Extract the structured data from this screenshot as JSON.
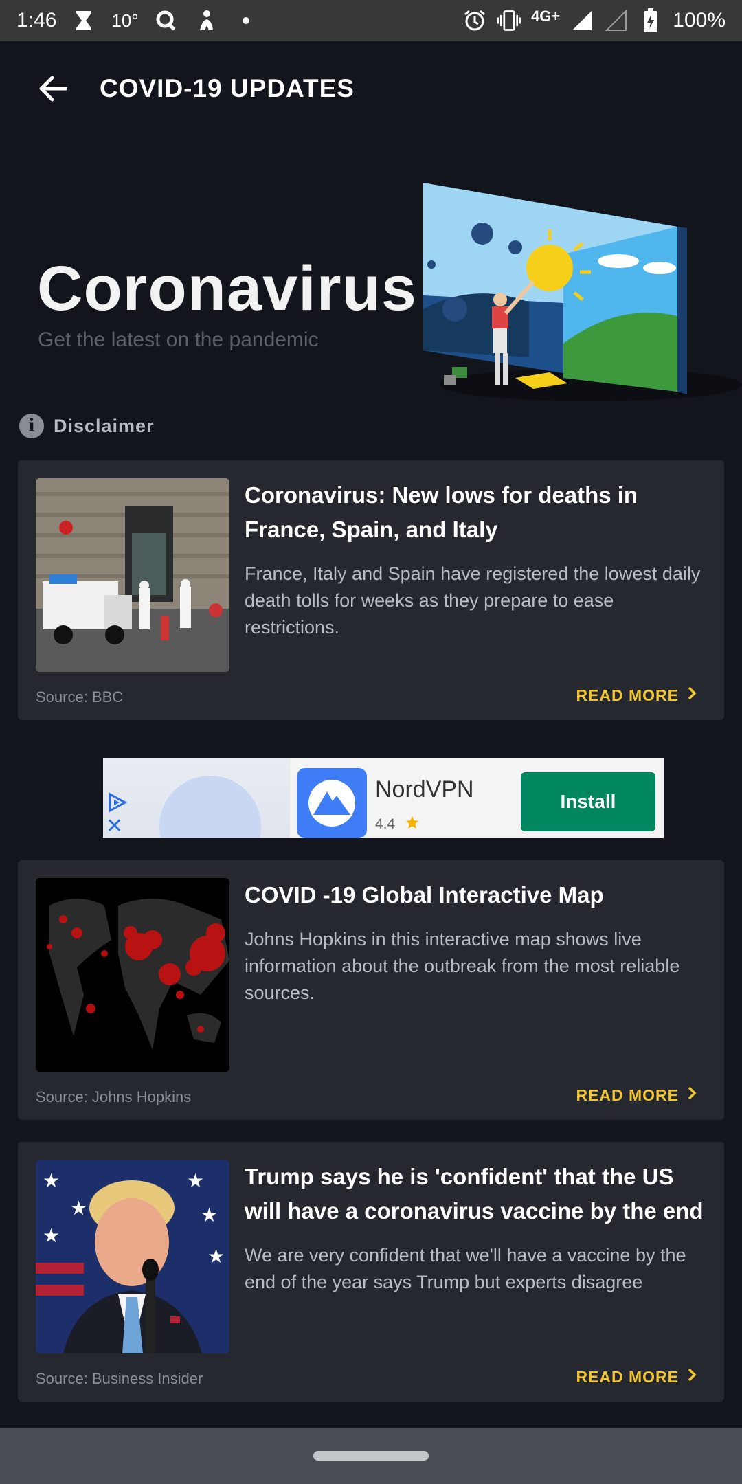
{
  "status_bar": {
    "time": "1:46",
    "temperature": "10°",
    "network": "4G+",
    "battery": "100%",
    "icons": [
      "hourglass-icon",
      "search-icon",
      "figure-icon",
      "dot-icon",
      "alarm-icon",
      "vibrate-icon",
      "signal-icon",
      "signal-empty-icon",
      "battery-charging-icon"
    ]
  },
  "app_bar": {
    "title": "COVID-19 UPDATES",
    "back_icon": "arrow-left-icon"
  },
  "hero": {
    "title": "Coronavirus",
    "subtitle": "Get the latest on the pandemic",
    "illustration": "person-painting-wall-illustration"
  },
  "disclaimer": {
    "label": "Disclaimer",
    "icon": "info-icon"
  },
  "articles": [
    {
      "title": "Coronavirus: New lows for deaths in France, Spain, and Italy",
      "description": "France, Italy and Spain have registered the lowest daily death tolls for weeks as they prepare to ease restrictions.",
      "source": "Source: BBC",
      "read_more": "READ MORE",
      "thumbnail": "street-disinfection-photo"
    },
    {
      "title": "COVID -19 Global Interactive Map",
      "description": "Johns Hopkins in this interactive map shows live information about the outbreak from the most reliable sources.",
      "source": "Source: Johns Hopkins",
      "read_more": "READ MORE",
      "thumbnail": "world-outbreak-map"
    },
    {
      "title": "Trump says he is 'confident' that the US will have a coronavirus vaccine by the end of th…",
      "description": "We are very confident that we'll have a vaccine by the end  of the year says Trump but experts disagree",
      "source": "Source: Business Insider",
      "read_more": "READ MORE",
      "thumbnail": "speaker-at-podium-photo"
    }
  ],
  "ad": {
    "app_name": "NordVPN",
    "rating": "4.4",
    "install_label": "Install",
    "icons": [
      "adchoices-icon",
      "close-icon",
      "star-icon",
      "nordvpn-logo"
    ]
  },
  "colors": {
    "background": "#13151d",
    "card": "#262830",
    "accent": "#f2c531",
    "install": "#01875f"
  }
}
